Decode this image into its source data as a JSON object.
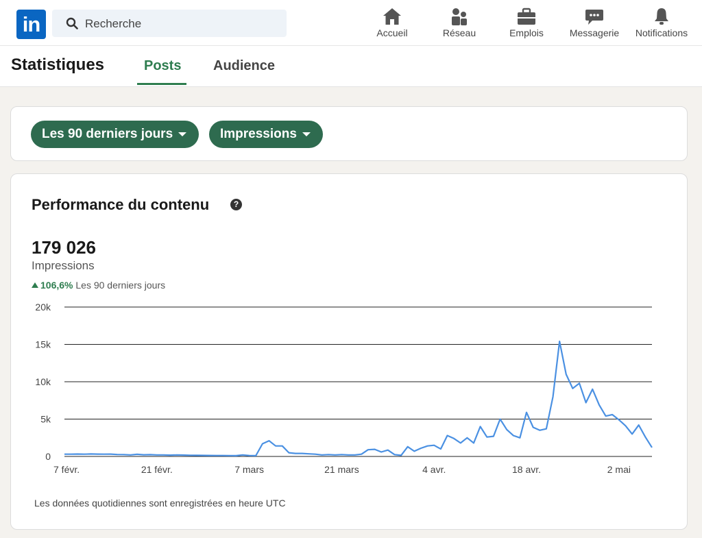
{
  "brand": {
    "logo_text": "in",
    "accent": "#0a66c2"
  },
  "search": {
    "placeholder": "Recherche"
  },
  "nav": {
    "items": [
      {
        "label": "Accueil",
        "icon": "home-icon"
      },
      {
        "label": "Réseau",
        "icon": "network-icon"
      },
      {
        "label": "Emplois",
        "icon": "briefcase-icon"
      },
      {
        "label": "Messagerie",
        "icon": "messaging-icon"
      },
      {
        "label": "Notifications",
        "icon": "bell-icon"
      }
    ]
  },
  "header": {
    "title": "Statistiques",
    "tabs": [
      {
        "label": "Posts",
        "active": true
      },
      {
        "label": "Audience",
        "active": false
      }
    ]
  },
  "filters": {
    "period": "Les 90 derniers jours",
    "metric": "Impressions",
    "pill_color": "#2e6b4f"
  },
  "performance": {
    "title": "Performance du contenu",
    "help_glyph": "?",
    "total": "179 026",
    "total_label": "Impressions",
    "change_pct": "106,6%",
    "change_period": "Les 90 derniers jours",
    "footnote": "Les données quotidiennes sont enregistrées en heure UTC"
  },
  "chart_data": {
    "type": "line",
    "series_color": "#4a90e2",
    "ylim": [
      0,
      20000
    ],
    "y_ticks": [
      {
        "value": 0,
        "label": "0"
      },
      {
        "value": 5000,
        "label": "5k"
      },
      {
        "value": 10000,
        "label": "10k"
      },
      {
        "value": 15000,
        "label": "15k"
      },
      {
        "value": 20000,
        "label": "20k"
      }
    ],
    "x_ticks": [
      {
        "index": 0,
        "label": "7 févr."
      },
      {
        "index": 14,
        "label": "21 févr."
      },
      {
        "index": 28,
        "label": "7 mars"
      },
      {
        "index": 42,
        "label": "21 mars"
      },
      {
        "index": 56,
        "label": "4 avr."
      },
      {
        "index": 70,
        "label": "18 avr."
      },
      {
        "index": 84,
        "label": "2 mai"
      }
    ],
    "grid": true,
    "values": [
      300,
      300,
      320,
      300,
      330,
      310,
      300,
      310,
      260,
      250,
      200,
      280,
      220,
      240,
      200,
      200,
      170,
      200,
      180,
      160,
      150,
      140,
      130,
      120,
      120,
      110,
      100,
      200,
      120,
      100,
      1700,
      2100,
      1400,
      1400,
      500,
      400,
      400,
      350,
      300,
      200,
      250,
      200,
      250,
      200,
      200,
      300,
      900,
      950,
      600,
      850,
      250,
      150,
      1300,
      700,
      1100,
      1400,
      1500,
      1000,
      2800,
      2400,
      1800,
      2500,
      1800,
      4000,
      2600,
      2700,
      5000,
      3600,
      2800,
      2500,
      5900,
      3900,
      3500,
      3700,
      8000,
      15400,
      11000,
      9100,
      9800,
      7200,
      9000,
      6900,
      5400,
      5600,
      4900,
      4100,
      3000,
      4200,
      2600,
      1200
    ]
  }
}
